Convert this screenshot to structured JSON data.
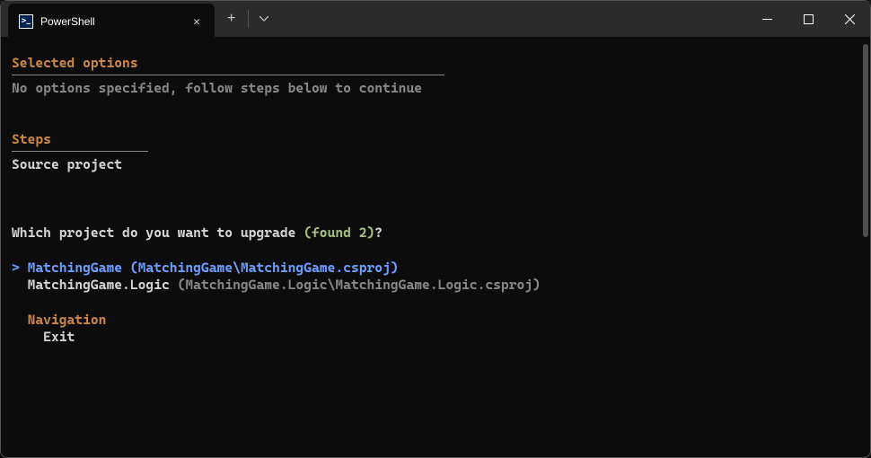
{
  "titlebar": {
    "tab_title": "PowerShell",
    "tab_icon_glyph": ">_"
  },
  "sections": {
    "selected_options_header": "Selected options",
    "selected_options_body": "No options specified, follow steps below to continue",
    "steps_header": "Steps",
    "steps_body": "Source project"
  },
  "prompt": {
    "question_prefix": "Which project do you want to upgrade ",
    "found_text": "(found 2)",
    "question_suffix": "?"
  },
  "options": [
    {
      "marker": "> ",
      "name": "MatchingGame ",
      "path": "(MatchingGame\\MatchingGame.csproj)",
      "selected": true
    },
    {
      "marker": "  ",
      "name": "MatchingGame.Logic ",
      "path": "(MatchingGame.Logic\\MatchingGame.Logic.csproj)",
      "selected": false
    }
  ],
  "navigation": {
    "header": "Navigation",
    "items": [
      "Exit"
    ]
  }
}
